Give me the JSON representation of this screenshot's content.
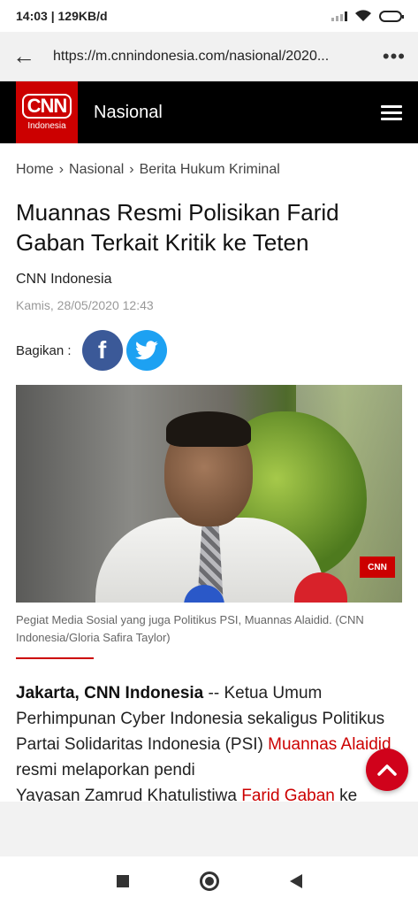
{
  "status_bar": {
    "time_speed": "14:03 | 129KB/d"
  },
  "browser": {
    "url": "https://m.cnnindonesia.com/nasional/2020...",
    "back_icon": "arrow-left-icon",
    "more_icon": "more-dots-icon"
  },
  "header": {
    "logo_text": "CNN",
    "logo_sub": "Indonesia",
    "section": "Nasional",
    "menu_icon": "hamburger-icon",
    "brand_color": "#cc0000"
  },
  "breadcrumb": {
    "items": [
      "Home",
      "Nasional",
      "Berita Hukum Kriminal"
    ],
    "separator": "›"
  },
  "article": {
    "title": "Muannas Resmi Polisikan Farid Gaban Terkait Kritik ke Teten",
    "source": "CNN Indonesia",
    "date": "Kamis, 28/05/2020 12:43",
    "share_label": "Bagikan :",
    "share_icons": [
      "facebook-icon",
      "twitter-icon"
    ],
    "photo_watermark": "CNN",
    "caption": "Pegiat Media Sosial yang juga Politikus PSI, Muannas Alaidid. (CNN Indonesia/Gloria Safira Taylor)",
    "body": {
      "dateline": "Jakarta, CNN Indonesia",
      "dash": " -- ",
      "text1": "Ketua Umum Perhimpunan Cyber Indonesia sekaligus Politikus Partai Solidaritas Indonesia (PSI) ",
      "link1": "Muannas Alaidid",
      "text2": " resmi melaporkan pendi",
      "text3": "Yayasan Zamrud Khatulistiwa ",
      "link2": "Farid Gaban",
      "text4": " ke"
    }
  },
  "fab": {
    "icon": "chevron-up-icon"
  },
  "nav_bar": {
    "icons": [
      "recent-apps-icon",
      "home-icon",
      "back-icon"
    ]
  }
}
